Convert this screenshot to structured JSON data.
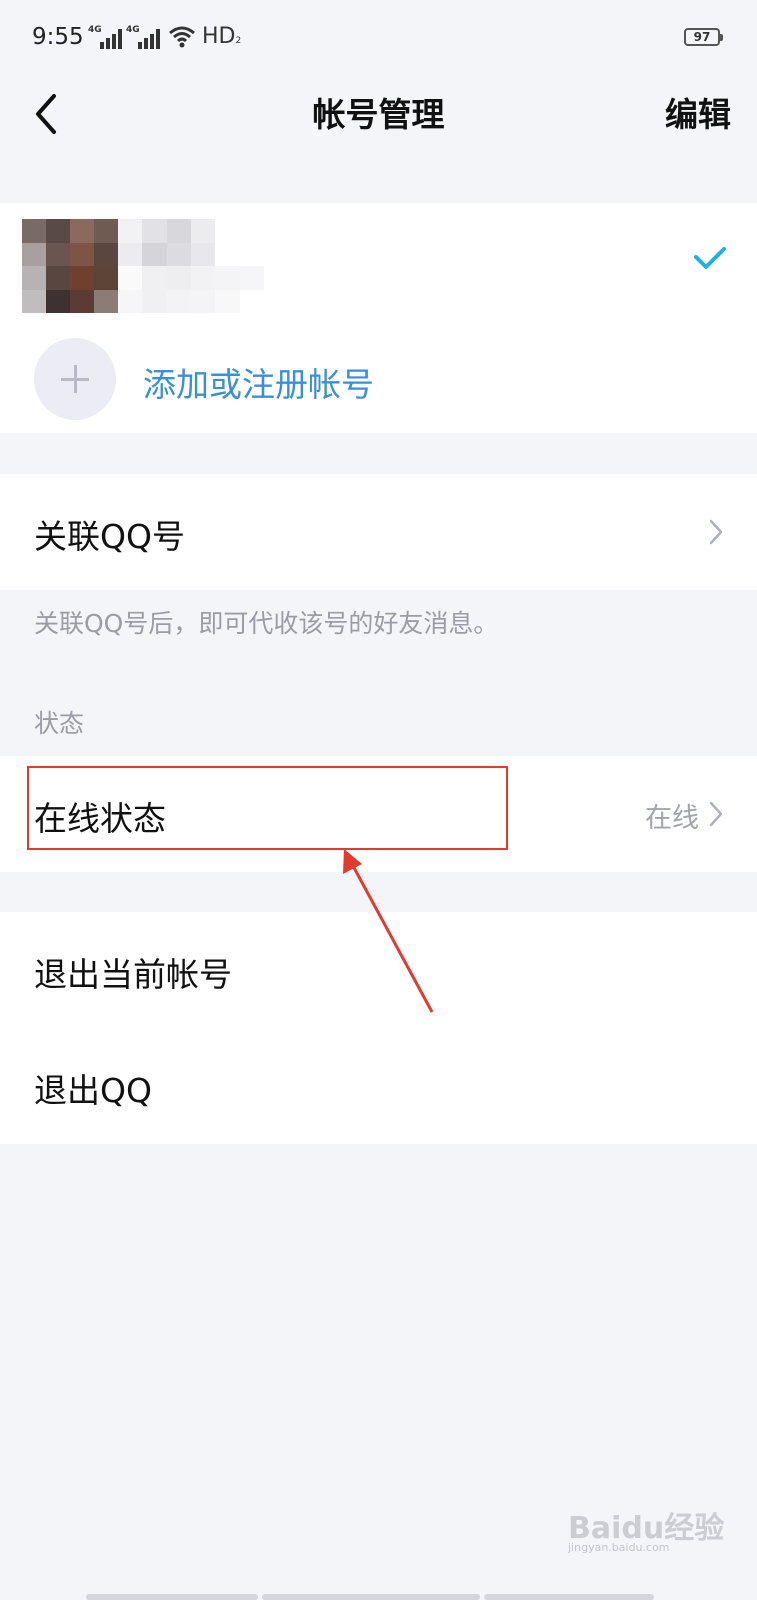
{
  "status_bar": {
    "time": "9:55",
    "signal_1": "4G",
    "signal_2": "4G",
    "hd_label": "HD",
    "hd_sub": "2",
    "battery": "97"
  },
  "nav": {
    "title": "帐号管理",
    "edit_label": "编辑"
  },
  "accounts": {
    "current_account_checked": true,
    "add_label": "添加或注册帐号"
  },
  "link_qq": {
    "label": "关联QQ号",
    "hint": "关联QQ号后，即可代收该号的好友消息。"
  },
  "status_section": {
    "title": "状态",
    "online_label": "在线状态",
    "online_value": "在线"
  },
  "logout": {
    "logout_current": "退出当前帐号",
    "exit_qq": "退出QQ"
  },
  "watermark": {
    "logo": "Baidu经验",
    "site": "jingyan.baidu.com"
  },
  "colors": {
    "accent_blue": "#3a8fd8",
    "check_cyan": "#1ab2e8",
    "annotation_red": "#e23a2e",
    "background": "#f4f5f9"
  }
}
